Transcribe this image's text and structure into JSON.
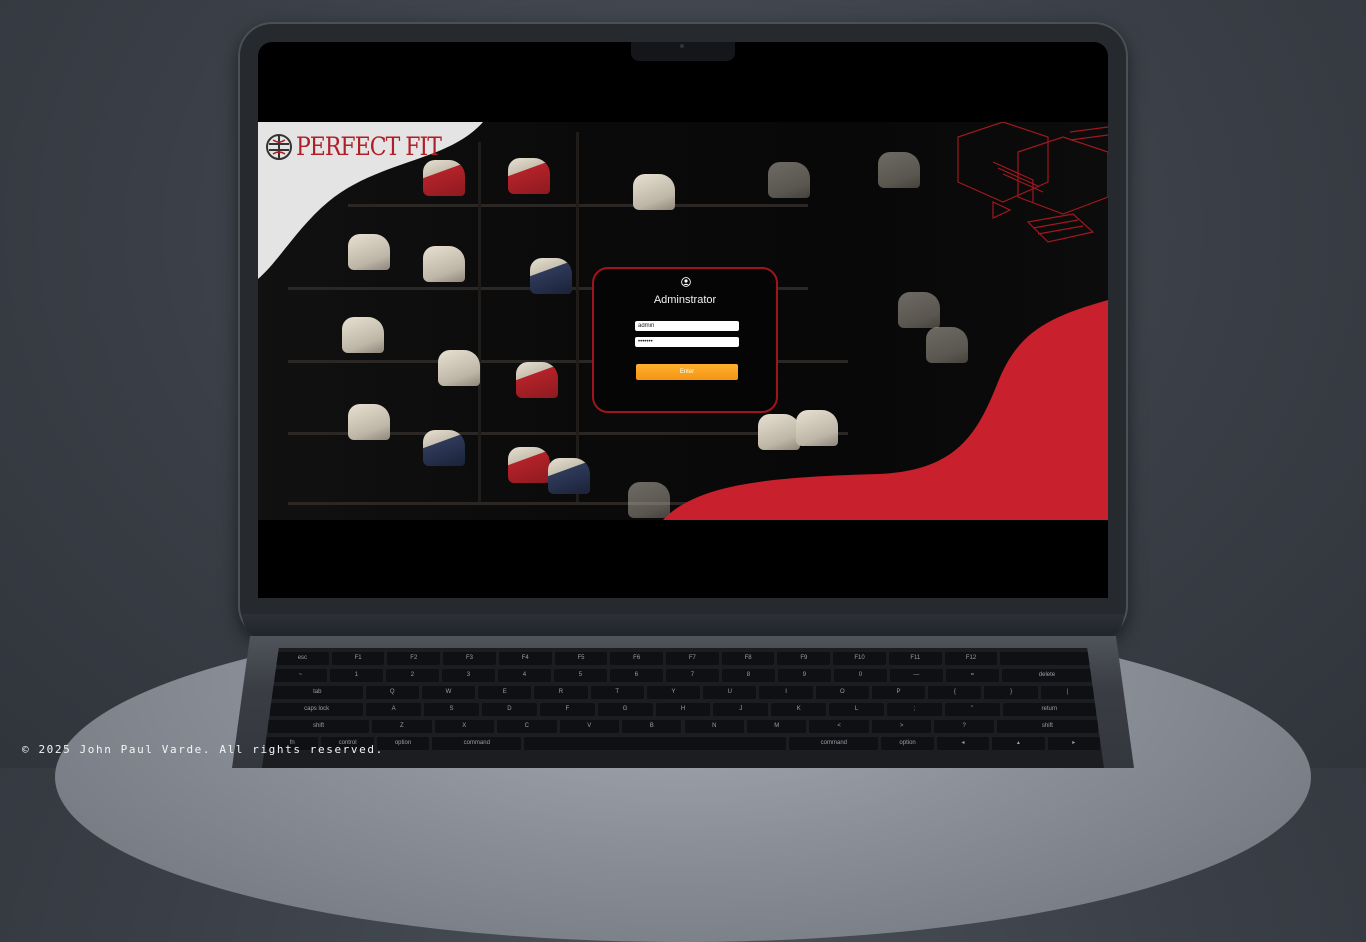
{
  "brand": {
    "name": "PERFECT FIT"
  },
  "login": {
    "title": "Adminstrator",
    "username_value": "admin",
    "password_value": "•••••••",
    "submit_label": "Enter"
  },
  "colors": {
    "accent_red": "#c8202c",
    "button_orange": "#f7a21b",
    "card_border": "#a0141c"
  },
  "icons": {
    "user": "user-circle-icon",
    "logo": "perfect-fit-logo-icon",
    "camera": "camera-icon"
  },
  "keyboard": {
    "rows": [
      [
        "esc",
        "F1",
        "F2",
        "F3",
        "F4",
        "F5",
        "F6",
        "F7",
        "F8",
        "F9",
        "F10",
        "F11",
        "F12",
        ""
      ],
      [
        "~",
        "1",
        "2",
        "3",
        "4",
        "5",
        "6",
        "7",
        "8",
        "9",
        "0",
        "—",
        "=",
        "delete"
      ],
      [
        "tab",
        "Q",
        "W",
        "E",
        "R",
        "T",
        "Y",
        "U",
        "I",
        "O",
        "P",
        "{",
        "}",
        "|"
      ],
      [
        "caps lock",
        "A",
        "S",
        "D",
        "F",
        "G",
        "H",
        "J",
        "K",
        "L",
        ";",
        "\"",
        "return"
      ],
      [
        "shift",
        "Z",
        "X",
        "C",
        "V",
        "B",
        "N",
        "M",
        "<",
        ">",
        "?",
        "shift"
      ],
      [
        "fn",
        "control",
        "option",
        "command",
        "",
        "command",
        "option",
        "◂",
        "▴",
        "▸"
      ]
    ]
  },
  "footer": {
    "text": "© 2025 John Paul Varde. All rights reserved."
  }
}
